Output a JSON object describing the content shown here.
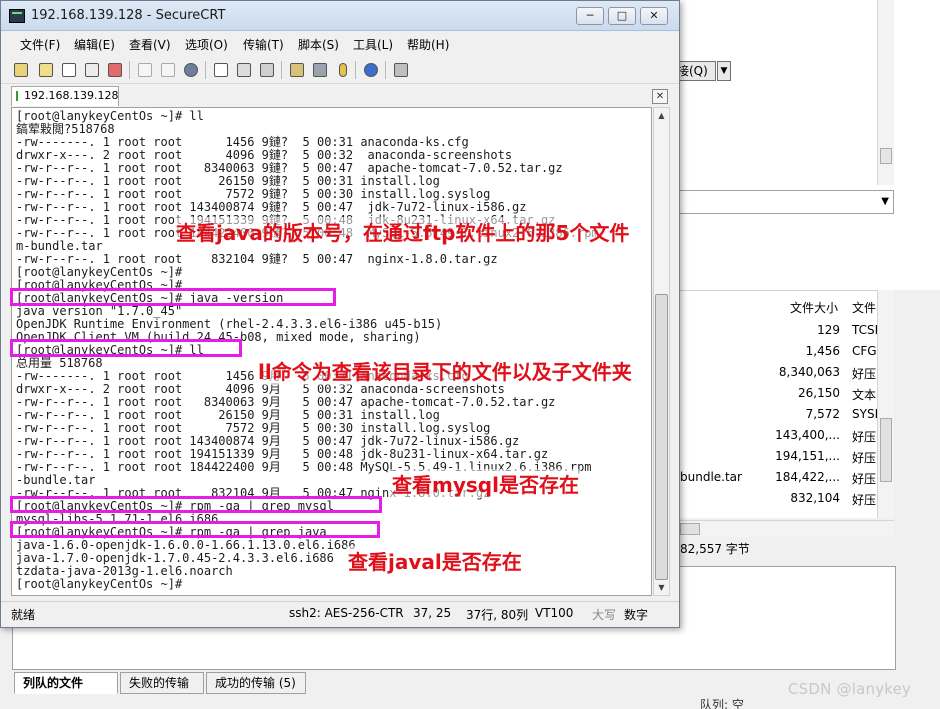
{
  "window": {
    "title": "192.168.139.128 - SecureCRT",
    "minimize": "─",
    "maximize": "□",
    "close": "✕"
  },
  "menu": [
    "文件(F)",
    "编辑(E)",
    "查看(V)",
    "选项(O)",
    "传输(T)",
    "脚本(S)",
    "工具(L)",
    "帮助(H)"
  ],
  "toolbar_icons": [
    "connect-icon",
    "quick-connect-icon",
    "connect-tab-icon",
    "reconnect-icon",
    "disconnect-icon",
    "copy-icon",
    "paste-icon",
    "find-icon",
    "print-setup-icon",
    "print-icon",
    "print-screen-icon",
    "session-options-icon",
    "global-options-icon",
    "key-icon",
    "help-icon",
    "sftp-icon"
  ],
  "session_tab": {
    "label": "192.168.139.128",
    "close": "✕"
  },
  "terminal_lines": [
    "[root@lanykeyCentOs ~]# ll",
    "鎬荤敤閲?518768",
    "-rw-------. 1 root root      1456 9鏈?  5 00:31 anaconda-ks.cfg",
    "drwxr-x---. 2 root root      4096 9鏈?  5 00:32  anaconda-screenshots",
    "-rw-r--r--. 1 root root   8340063 9鏈?  5 00:47  apache-tomcat-7.0.52.tar.gz",
    "-rw-r--r--. 1 root root     26150 9鏈?  5 00:31 install.log",
    "-rw-r--r--. 1 root root      7572 9鏈?  5 00:30 install.log.syslog",
    "-rw-r--r--. 1 root root 143400874 9鏈?  5 00:47  jdk-7u72-linux-i586.gz",
    "-rw-r--r--. 1 root root 194151339 9鏈?  5 00:48  jdk-8u231-linux-x64.tar.gz",
    "-rw-r--r--. 1 root root 184422400 9鏈?  5 00:48  MySQL-5.5.49-1.linux2.6.i386.rpm",
    "m-bundle.tar",
    "-rw-r--r--. 1 root root    832104 9鏈?  5 00:47  nginx-1.8.0.tar.gz",
    "[root@lanykeyCentOs ~]#",
    "[root@lanykeyCentOs ~]#",
    "[root@lanykeyCentOs ~]# java -version",
    "java version \"1.7.0_45\"",
    "OpenJDK Runtime Environment (rhel-2.4.3.3.el6-i386 u45-b15)",
    "OpenJDK Client VM (build 24.45-b08, mixed mode, sharing)",
    "[root@lanykeyCentOs ~]# ll",
    "总用量 518768",
    "-rw-------. 1 root root      1456 9月   5 00:31 anaconda-ks.cfg",
    "drwxr-x---. 2 root root      4096 9月   5 00:32 anaconda-screenshots",
    "-rw-r--r--. 1 root root   8340063 9月   5 00:47 apache-tomcat-7.0.52.tar.gz",
    "-rw-r--r--. 1 root root     26150 9月   5 00:31 install.log",
    "-rw-r--r--. 1 root root      7572 9月   5 00:30 install.log.syslog",
    "-rw-r--r--. 1 root root 143400874 9月   5 00:47 jdk-7u72-linux-i586.gz",
    "-rw-r--r--. 1 root root 194151339 9月   5 00:48 jdk-8u231-linux-x64.tar.gz",
    "-rw-r--r--. 1 root root 184422400 9月   5 00:48 MySQL-5.5.49-1.linux2.6.i386.rpm",
    "-bundle.tar",
    "-rw-r--r--. 1 root root    832104 9月   5 00:47 nginx-1.8.0.tar.gz",
    "[root@lanykeyCentOs ~]# rpm -qa | grep mysql",
    "mysql-libs-5.1.71-1.el6.i686",
    "[root@lanykeyCentOs ~]# rpm -qa | grep java",
    "java-1.6.0-openjdk-1.6.0.0-1.66.1.13.0.el6.i686",
    "java-1.7.0-openjdk-1.7.0.45-2.4.3.3.el6.i686",
    "tzdata-java-2013g-1.el6.noarch",
    "[root@lanykeyCentOs ~]#"
  ],
  "annotations": {
    "note_java_version": "查看java的版本号，在通过ftp软件上的那5个文件",
    "note_ll": "ll命令为查看该目录下的文件以及子文件夹",
    "note_mysql": "查看mysql是否存在",
    "note_java": "查看javal是否存在"
  },
  "statusbar": {
    "ready": "就绪",
    "cipher": "ssh2: AES-256-CTR",
    "cursor": "37,  25",
    "size": "37行, 80列",
    "term": "VT100",
    "caps": "大写",
    "num": "数字"
  },
  "ftp": {
    "query_btn": "接(Q)",
    "col_size": "文件大小",
    "col_type": "文件",
    "rows": [
      {
        "name": "",
        "size": "129",
        "type": "TCSI"
      },
      {
        "name": "",
        "size": "1,456",
        "type": "CFG"
      },
      {
        "name": "",
        "size": "8,340,063",
        "type": "好压"
      },
      {
        "name": "",
        "size": "26,150",
        "type": "文本"
      },
      {
        "name": "",
        "size": "7,572",
        "type": "SYSL"
      },
      {
        "name": "",
        "size": "143,400,...",
        "type": "好压"
      },
      {
        "name": "",
        "size": "194,151,...",
        "type": "好压"
      },
      {
        "name": "bundle.tar",
        "size": "184,422,...",
        "type": "好压"
      },
      {
        "name": "",
        "size": "832,104",
        "type": "好压"
      }
    ],
    "status_bytes": "82,557 字节",
    "tabs": [
      "列队的文件",
      "失败的传输",
      "成功的传输 (5)"
    ],
    "bottom_text": "队列: 空"
  },
  "watermark": "CSDN @lanykey",
  "colors": {
    "highlight_box": "#e41ee6",
    "annotation_text": "#e0101a"
  }
}
